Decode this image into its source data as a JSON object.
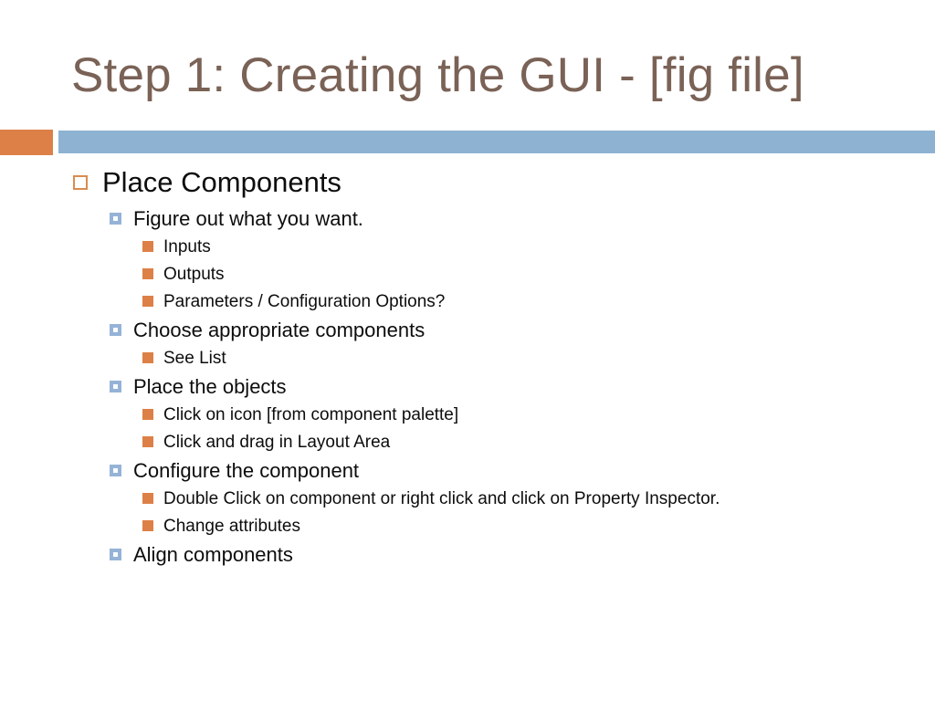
{
  "slide": {
    "title": "Step 1: Creating the GUI - [fig file]",
    "title_color": "#7a6256",
    "divider": {
      "accent_color": "#dd8047",
      "bar_color": "#8eb2d2"
    },
    "bullets": {
      "level1_marker": "hollow-orange-square",
      "level2_marker": "blue-square-outline",
      "level3_marker": "solid-orange-square",
      "level1_color": "#d98c50",
      "level2_color": "#95b3d7",
      "level3_color": "#dd8047"
    },
    "content": [
      {
        "level": 1,
        "text": "Place Components"
      },
      {
        "level": 2,
        "text": "Figure out what you want."
      },
      {
        "level": 3,
        "text": "Inputs"
      },
      {
        "level": 3,
        "text": "Outputs"
      },
      {
        "level": 3,
        "text": "Parameters / Configuration Options?"
      },
      {
        "level": 2,
        "text": "Choose appropriate components"
      },
      {
        "level": 3,
        "text": "See List"
      },
      {
        "level": 2,
        "text": "Place the objects"
      },
      {
        "level": 3,
        "text": "Click on icon [from component palette]"
      },
      {
        "level": 3,
        "text": "Click and drag in Layout Area"
      },
      {
        "level": 2,
        "text": "Configure the component"
      },
      {
        "level": 3,
        "text": "Double Click on component or right click and click on Property Inspector."
      },
      {
        "level": 3,
        "text": "Change attributes"
      },
      {
        "level": 2,
        "text": "Align components"
      }
    ]
  }
}
